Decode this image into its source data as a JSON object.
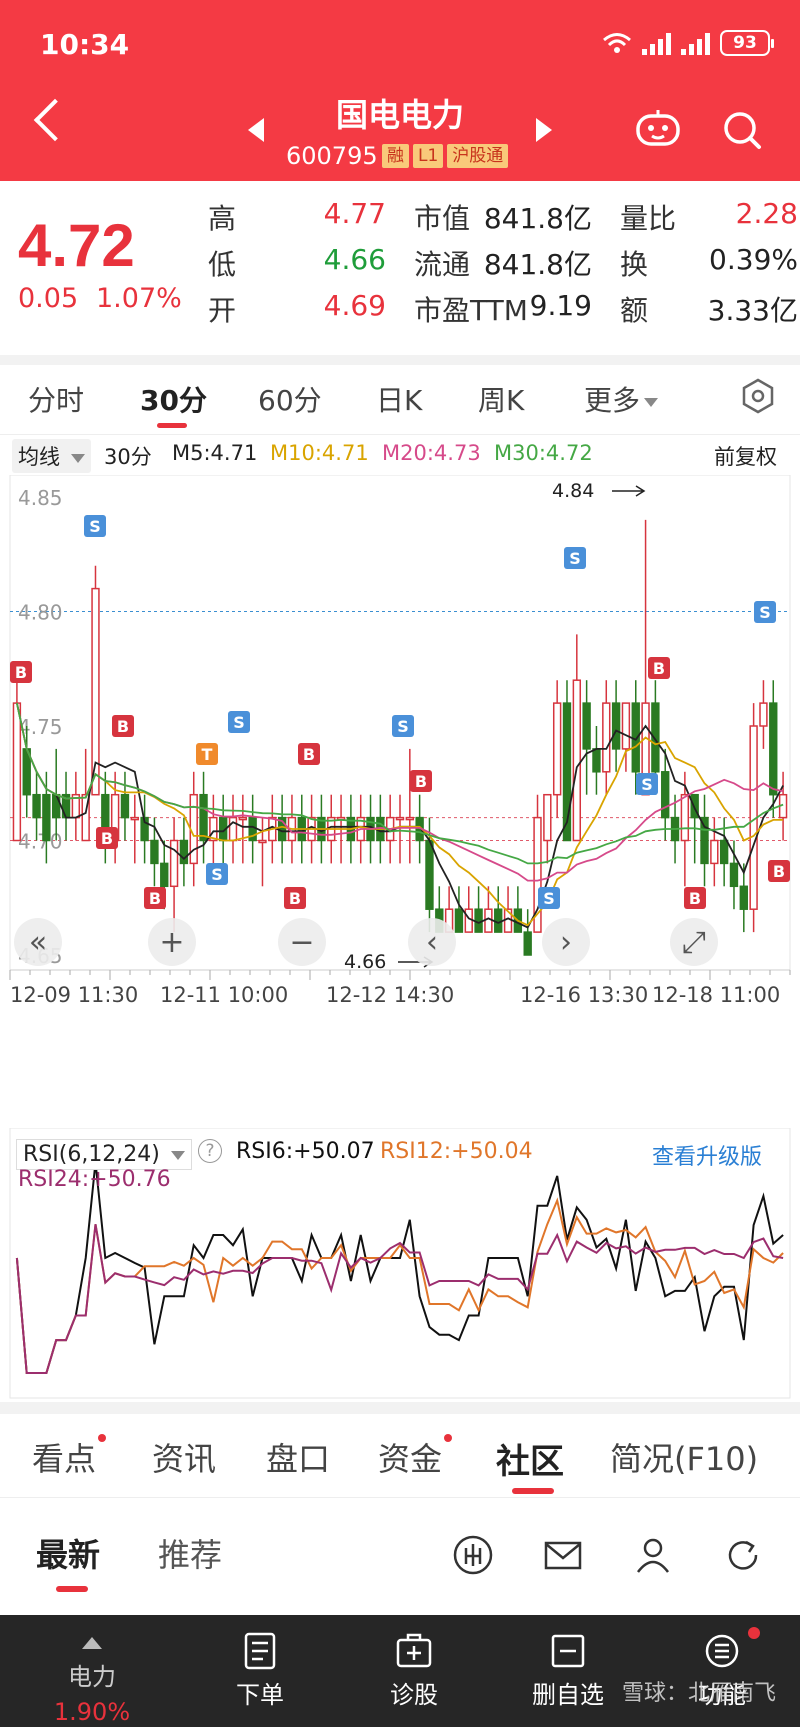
{
  "status": {
    "time": "10:34",
    "battery": "93"
  },
  "header": {
    "name": "国电电力",
    "code": "600795",
    "tags": [
      "融",
      "L1",
      "沪股通"
    ]
  },
  "quote": {
    "price": "4.72",
    "change": "0.05",
    "change_pct": "1.07%",
    "rows": [
      {
        "l1": "高",
        "v1": "4.77",
        "c1": "red",
        "l2": "市值",
        "v2": "841.8亿",
        "l3": "量比",
        "v3": "2.28",
        "c3": "red"
      },
      {
        "l1": "低",
        "v1": "4.66",
        "c1": "green",
        "l2": "流通",
        "v2": "841.8亿",
        "l3": "换",
        "v3": "0.39%",
        "c3": "dark"
      },
      {
        "l1": "开",
        "v1": "4.69",
        "c1": "red",
        "l2": "市盈TTM",
        "v2": "9.19",
        "l3": "额",
        "v3": "3.33亿",
        "c3": "dark"
      }
    ]
  },
  "ktabs": [
    "分时",
    "30分",
    "60分",
    "日K",
    "周K",
    "更多"
  ],
  "ma": {
    "selector": "均线",
    "period": "30分",
    "m5": "M5:4.71",
    "m10": "M10:4.71",
    "m20": "M20:4.73",
    "m30": "M30:4.72",
    "adjust": "前复权",
    "colors": {
      "m5": "#222222",
      "m10": "#d9a400",
      "m20": "#d64a8a",
      "m30": "#45a845"
    }
  },
  "chart_data": {
    "type": "candlestick",
    "y_ticks": [
      "4.85",
      "4.80",
      "4.75",
      "4.70",
      "4.65"
    ],
    "x_ticks": [
      "12-09 11:30",
      "12-11 10:00",
      "12-12 14:30",
      "12-16 13:30",
      "12-18 11:00"
    ],
    "high_note": "4.84",
    "low_note": "4.66",
    "candles": [
      [
        4.7,
        4.76,
        4.7,
        4.77
      ],
      [
        4.74,
        4.72,
        4.71,
        4.75
      ],
      [
        4.72,
        4.71,
        4.7,
        4.73
      ],
      [
        4.72,
        4.7,
        4.69,
        4.73
      ],
      [
        4.72,
        4.71,
        4.7,
        4.74
      ],
      [
        4.72,
        4.71,
        4.7,
        4.73
      ],
      [
        4.71,
        4.72,
        4.7,
        4.73
      ],
      [
        4.7,
        4.72,
        4.7,
        4.74
      ],
      [
        4.72,
        4.81,
        4.72,
        4.82
      ],
      [
        4.72,
        4.7,
        4.69,
        4.73
      ],
      [
        4.7,
        4.72,
        4.69,
        4.73
      ],
      [
        4.72,
        4.71,
        4.7,
        4.73
      ],
      [
        4.71,
        4.71,
        4.69,
        4.72
      ],
      [
        4.71,
        4.7,
        4.69,
        4.72
      ],
      [
        4.7,
        4.69,
        4.68,
        4.71
      ],
      [
        4.69,
        4.68,
        4.67,
        4.7
      ],
      [
        4.68,
        4.7,
        4.66,
        4.71
      ],
      [
        4.7,
        4.69,
        4.68,
        4.71
      ],
      [
        4.69,
        4.72,
        4.68,
        4.73
      ],
      [
        4.72,
        4.7,
        4.69,
        4.73
      ],
      [
        4.7,
        4.71,
        4.69,
        4.72
      ],
      [
        4.71,
        4.7,
        4.69,
        4.72
      ],
      [
        4.7,
        4.71,
        4.69,
        4.72
      ],
      [
        4.71,
        4.71,
        4.69,
        4.72
      ],
      [
        4.71,
        4.7,
        4.69,
        4.72
      ],
      [
        4.7,
        4.7,
        4.68,
        4.71
      ],
      [
        4.7,
        4.71,
        4.69,
        4.72
      ],
      [
        4.71,
        4.7,
        4.69,
        4.72
      ],
      [
        4.7,
        4.71,
        4.69,
        4.72
      ],
      [
        4.71,
        4.7,
        4.69,
        4.72
      ],
      [
        4.7,
        4.71,
        4.69,
        4.72
      ],
      [
        4.71,
        4.7,
        4.69,
        4.72
      ],
      [
        4.7,
        4.71,
        4.69,
        4.72
      ],
      [
        4.71,
        4.71,
        4.69,
        4.72
      ],
      [
        4.71,
        4.7,
        4.69,
        4.72
      ],
      [
        4.7,
        4.71,
        4.69,
        4.72
      ],
      [
        4.71,
        4.7,
        4.69,
        4.72
      ],
      [
        4.71,
        4.7,
        4.69,
        4.72
      ],
      [
        4.7,
        4.71,
        4.69,
        4.72
      ],
      [
        4.71,
        4.71,
        4.69,
        4.72
      ],
      [
        4.71,
        4.71,
        4.69,
        4.74
      ],
      [
        4.71,
        4.7,
        4.69,
        4.72
      ],
      [
        4.7,
        4.67,
        4.66,
        4.71
      ],
      [
        4.67,
        4.66,
        4.66,
        4.68
      ],
      [
        4.66,
        4.67,
        4.66,
        4.68
      ],
      [
        4.67,
        4.66,
        4.66,
        4.68
      ],
      [
        4.66,
        4.67,
        4.66,
        4.68
      ],
      [
        4.67,
        4.66,
        4.66,
        4.68
      ],
      [
        4.66,
        4.67,
        4.66,
        4.68
      ],
      [
        4.67,
        4.66,
        4.66,
        4.68
      ],
      [
        4.66,
        4.67,
        4.66,
        4.68
      ],
      [
        4.67,
        4.66,
        4.66,
        4.68
      ],
      [
        4.66,
        4.65,
        4.65,
        4.67
      ],
      [
        4.66,
        4.71,
        4.66,
        4.72
      ],
      [
        4.7,
        4.72,
        4.69,
        4.72
      ],
      [
        4.72,
        4.76,
        4.71,
        4.77
      ],
      [
        4.76,
        4.7,
        4.7,
        4.77
      ],
      [
        4.7,
        4.77,
        4.7,
        4.79
      ],
      [
        4.76,
        4.74,
        4.72,
        4.77
      ],
      [
        4.74,
        4.73,
        4.72,
        4.75
      ],
      [
        4.73,
        4.76,
        4.72,
        4.77
      ],
      [
        4.76,
        4.74,
        4.73,
        4.77
      ],
      [
        4.74,
        4.76,
        4.73,
        4.76
      ],
      [
        4.76,
        4.73,
        4.72,
        4.77
      ],
      [
        4.72,
        4.76,
        4.72,
        4.84
      ],
      [
        4.76,
        4.73,
        4.72,
        4.77
      ],
      [
        4.73,
        4.71,
        4.7,
        4.74
      ],
      [
        4.71,
        4.7,
        4.69,
        4.72
      ],
      [
        4.7,
        4.72,
        4.68,
        4.73
      ],
      [
        4.72,
        4.71,
        4.69,
        4.72
      ],
      [
        4.71,
        4.69,
        4.68,
        4.72
      ],
      [
        4.69,
        4.7,
        4.68,
        4.71
      ],
      [
        4.7,
        4.69,
        4.68,
        4.71
      ],
      [
        4.69,
        4.68,
        4.67,
        4.7
      ],
      [
        4.68,
        4.67,
        4.66,
        4.69
      ],
      [
        4.67,
        4.75,
        4.66,
        4.76
      ],
      [
        4.75,
        4.76,
        4.74,
        4.77
      ],
      [
        4.76,
        4.72,
        4.71,
        4.77
      ],
      [
        4.71,
        4.72,
        4.7,
        4.73
      ]
    ]
  },
  "rsi": {
    "label": "RSI(6,12,24)",
    "rsi6": "RSI6:+50.07",
    "rsi12": "RSI12:+50.04",
    "rsi24": "RSI24:+50.76",
    "upgrade": "查看升级版",
    "colors": {
      "rsi6": "#111111",
      "rsi12": "#e0762a",
      "rsi24": "#9c2e6e"
    }
  },
  "sections": [
    "看点",
    "资讯",
    "盘口",
    "资金",
    "社区",
    "简况(F10)"
  ],
  "subtabs": [
    "最新",
    "推荐"
  ],
  "toolbar": {
    "items": [
      {
        "label": "电力",
        "sub": "1.90%"
      },
      {
        "label": "下单"
      },
      {
        "label": "诊股"
      },
      {
        "label": "删自选"
      },
      {
        "label": "功能"
      }
    ]
  },
  "watermark": "雪球：北雁南飞"
}
